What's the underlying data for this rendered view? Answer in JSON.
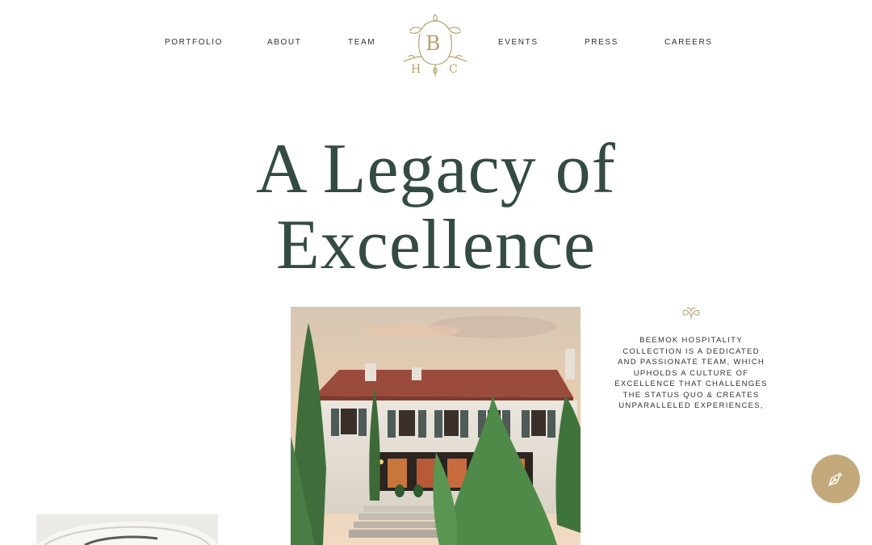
{
  "nav": {
    "left": [
      {
        "label": "PORTFOLIO"
      },
      {
        "label": "ABOUT"
      },
      {
        "label": "TEAM"
      }
    ],
    "right": [
      {
        "label": "EVENTS"
      },
      {
        "label": "PRESS"
      },
      {
        "label": "CAREERS"
      }
    ]
  },
  "logo": {
    "top_letter": "B",
    "bottom_left": "H",
    "bottom_right": "C",
    "icon": "monogram-logo"
  },
  "hero": {
    "line1": "A Legacy of",
    "line2": "Excellence"
  },
  "intro": {
    "ornament_icon": "flourish-ornament-icon",
    "text": "BEEMOK HOSPITALITY COLLECTION IS A DEDICATED AND PASSIONATE TEAM, WHICH UPHOLDS A CULTURE OF EXCELLENCE THAT CHALLENGES THE STATUS QUO & CREATES UNPARALLELED EXPERIENCES,"
  },
  "fab": {
    "icon": "pen-nib-icon"
  },
  "colors": {
    "heading": "#344b43",
    "gold": "#b8a06e",
    "fab": "#c3a97a",
    "text": "#2d3230",
    "background": "#ffffff"
  }
}
